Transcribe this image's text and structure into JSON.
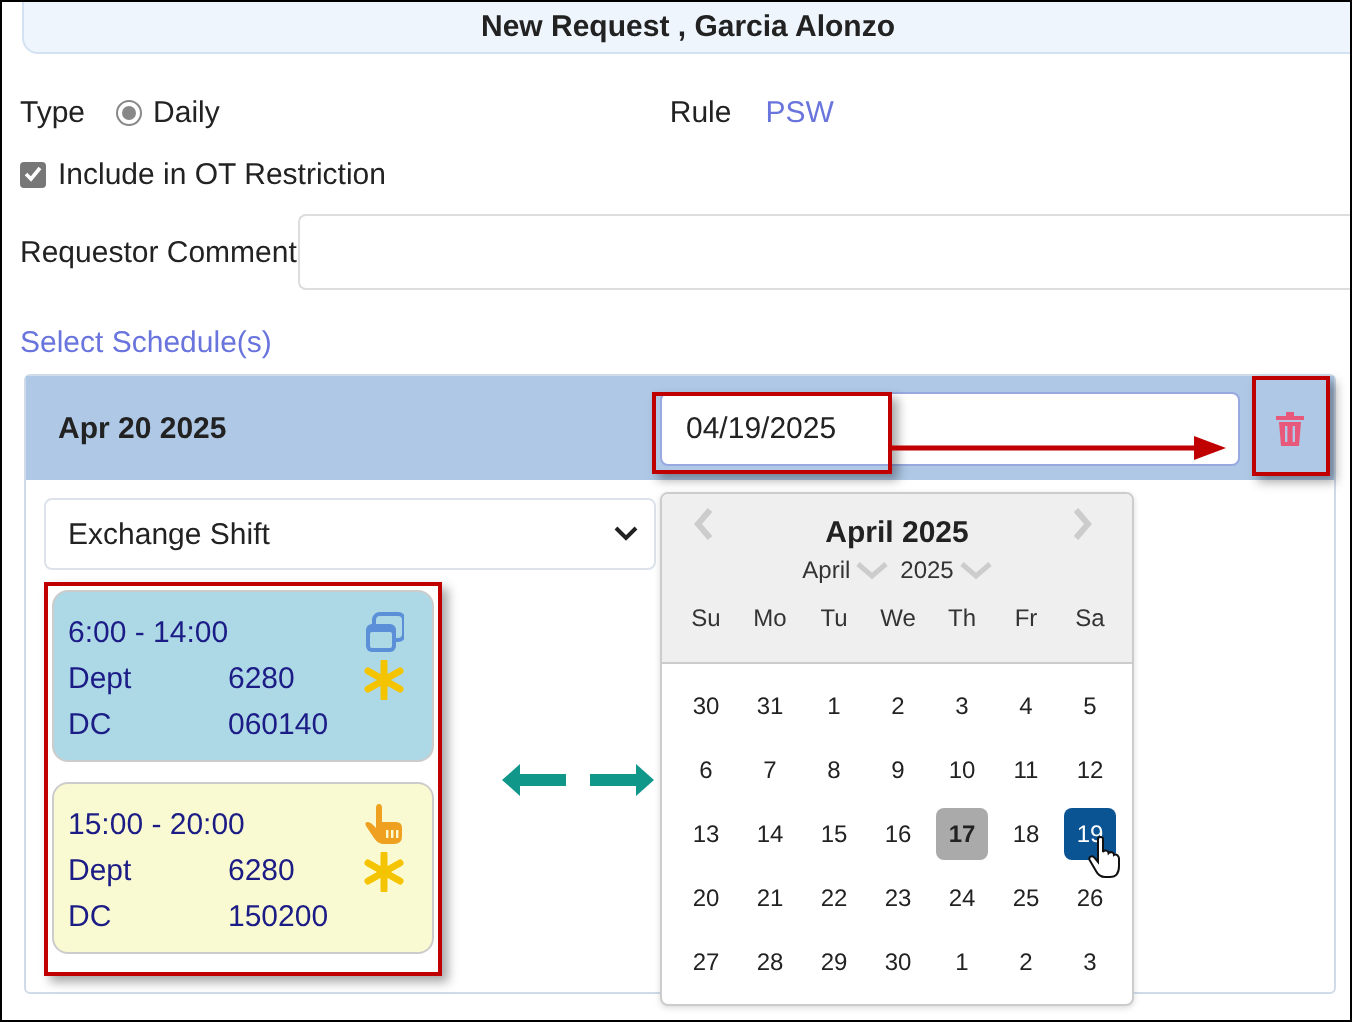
{
  "title": "New Request , Garcia Alonzo",
  "type": {
    "label": "Type",
    "options": [
      {
        "label": "Daily",
        "selected": true
      }
    ]
  },
  "rule": {
    "label": "Rule",
    "value": "PSW"
  },
  "ot_restriction": {
    "label": "Include in OT Restriction",
    "checked": true
  },
  "comment": {
    "label": "Requestor Comment"
  },
  "select_schedules_link": "Select Schedule(s)",
  "schedule": {
    "date": "Apr 20 2025",
    "date_field": {
      "value": "04/19/2025"
    },
    "request_type": {
      "value": "Exchange Shift"
    },
    "shifts": [
      {
        "kind": "current",
        "color": "#add8e6",
        "time": "6:00 - 14:00",
        "fields": [
          {
            "label": "Dept",
            "value": "6280"
          },
          {
            "label": "DC",
            "value": "060140"
          }
        ]
      },
      {
        "kind": "target",
        "color": "#fafad2",
        "time": "15:00 - 20:00",
        "fields": [
          {
            "label": "Dept",
            "value": "6280"
          },
          {
            "label": "DC",
            "value": "150200"
          }
        ]
      }
    ]
  },
  "calendar": {
    "title": "April 2025",
    "month": "April",
    "year": "2025",
    "weekdays": [
      "Su",
      "Mo",
      "Tu",
      "We",
      "Th",
      "Fr",
      "Sa"
    ],
    "weeks": [
      [
        {
          "label": "30",
          "selected": false,
          "today": false
        },
        {
          "label": "31",
          "selected": false,
          "today": false
        },
        {
          "label": "1",
          "selected": false,
          "today": false
        },
        {
          "label": "2",
          "selected": false,
          "today": false
        },
        {
          "label": "3",
          "selected": false,
          "today": false
        },
        {
          "label": "4",
          "selected": false,
          "today": false
        },
        {
          "label": "5",
          "selected": false,
          "today": false
        }
      ],
      [
        {
          "label": "6",
          "selected": false,
          "today": false
        },
        {
          "label": "7",
          "selected": false,
          "today": false
        },
        {
          "label": "8",
          "selected": false,
          "today": false
        },
        {
          "label": "9",
          "selected": false,
          "today": false
        },
        {
          "label": "10",
          "selected": false,
          "today": false
        },
        {
          "label": "11",
          "selected": false,
          "today": false
        },
        {
          "label": "12",
          "selected": false,
          "today": false
        }
      ],
      [
        {
          "label": "13",
          "selected": false,
          "today": false
        },
        {
          "label": "14",
          "selected": false,
          "today": false
        },
        {
          "label": "15",
          "selected": false,
          "today": false
        },
        {
          "label": "16",
          "selected": false,
          "today": false
        },
        {
          "label": "17",
          "selected": false,
          "today": true
        },
        {
          "label": "18",
          "selected": false,
          "today": false
        },
        {
          "label": "19",
          "selected": true,
          "today": false
        }
      ],
      [
        {
          "label": "20",
          "selected": false,
          "today": false
        },
        {
          "label": "21",
          "selected": false,
          "today": false
        },
        {
          "label": "22",
          "selected": false,
          "today": false
        },
        {
          "label": "23",
          "selected": false,
          "today": false
        },
        {
          "label": "24",
          "selected": false,
          "today": false
        },
        {
          "label": "25",
          "selected": false,
          "today": false
        },
        {
          "label": "26",
          "selected": false,
          "today": false
        }
      ],
      [
        {
          "label": "27",
          "selected": false,
          "today": false
        },
        {
          "label": "28",
          "selected": false,
          "today": false
        },
        {
          "label": "29",
          "selected": false,
          "today": false
        },
        {
          "label": "30",
          "selected": false,
          "today": false
        },
        {
          "label": "1",
          "selected": false,
          "today": false
        },
        {
          "label": "2",
          "selected": false,
          "today": false
        },
        {
          "label": "3",
          "selected": false,
          "today": false
        }
      ]
    ]
  }
}
